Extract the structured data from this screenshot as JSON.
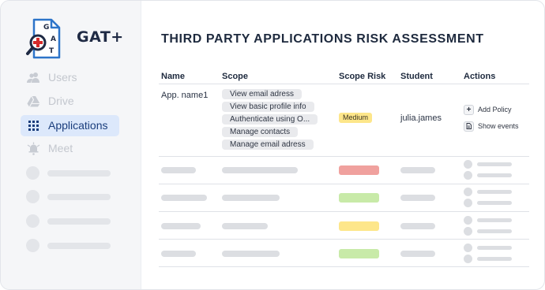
{
  "brand": {
    "name": "GAT+"
  },
  "sidebar": {
    "items": [
      {
        "label": "Users",
        "icon": "users-icon",
        "active": false
      },
      {
        "label": "Drive",
        "icon": "drive-icon",
        "active": false
      },
      {
        "label": "Applications",
        "icon": "grid-icon",
        "active": true
      },
      {
        "label": "Meet",
        "icon": "meet-icon",
        "active": false
      }
    ]
  },
  "main": {
    "title": "THIRD PARTY APPLICATIONS RISK ASSESSMENT",
    "columns": [
      "Name",
      "Scope",
      "Scope Risk",
      "Student",
      "Actions"
    ],
    "row": {
      "name": "App. name1",
      "scopes": [
        "View email adress",
        "View basic profile info",
        "Authenticate using O...",
        "Manage contacts",
        "Manage email adress"
      ],
      "scope_risk": "Medium",
      "student": "julia.james",
      "actions": [
        {
          "label": "Add Policy",
          "icon": "plus-icon"
        },
        {
          "label": "Show events",
          "icon": "document-icon"
        }
      ]
    },
    "placeholder_rows": [
      {
        "risk_level": "high"
      },
      {
        "risk_level": "low"
      },
      {
        "risk_level": "medium"
      },
      {
        "risk_level": "low"
      }
    ]
  },
  "colors": {
    "active_nav_bg": "#dce8fb",
    "risk_high": "#f0a19e",
    "risk_medium": "#fde68a",
    "risk_low": "#c8eaa8"
  }
}
